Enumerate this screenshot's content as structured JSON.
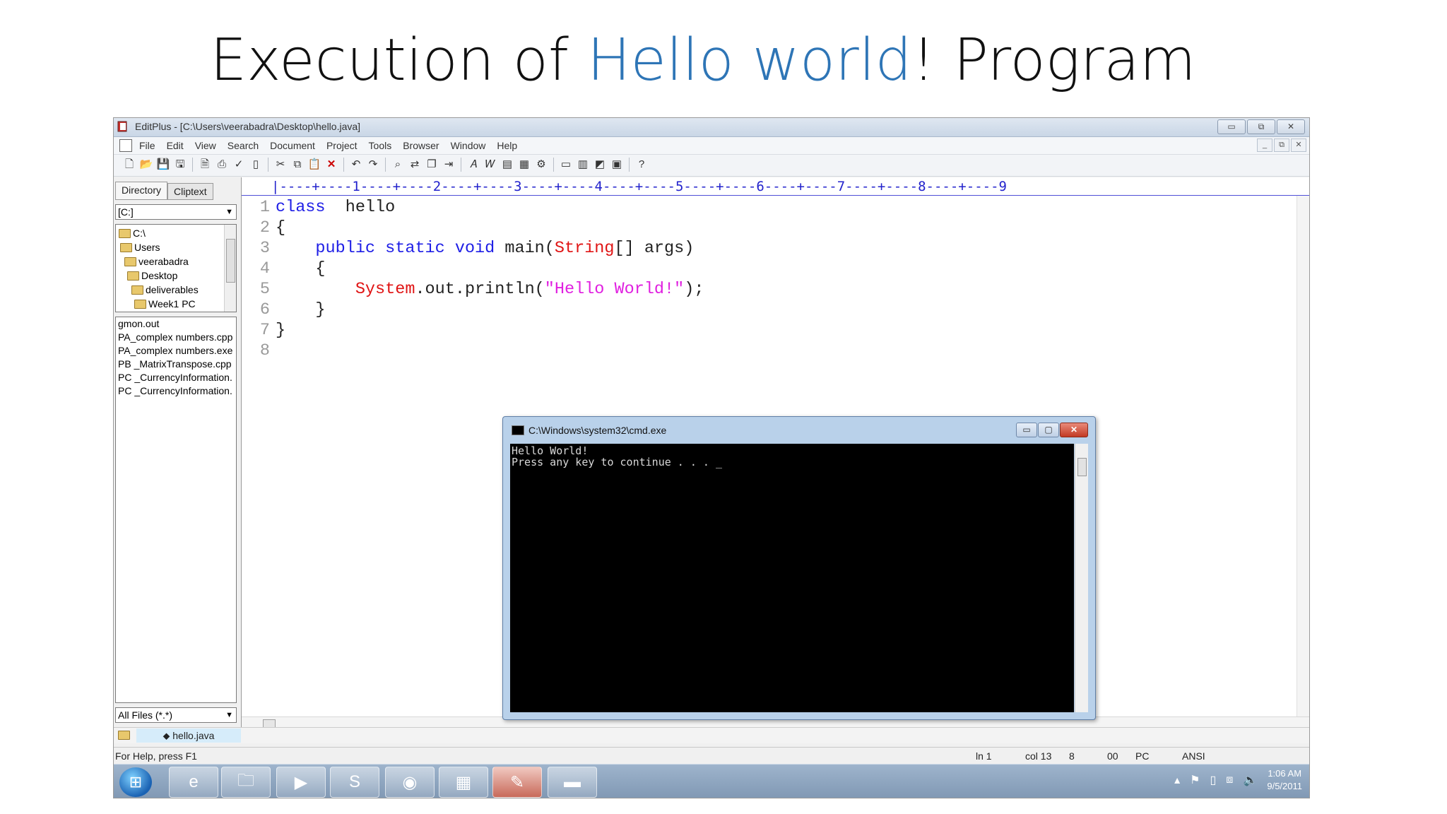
{
  "slide": {
    "title_pre": "Execution of ",
    "title_hl": "Hello world",
    "title_post": "! Program"
  },
  "window": {
    "title": "EditPlus - [C:\\Users\\veerabadra\\Desktop\\hello.java]",
    "btn_min": "▭",
    "btn_max": "⧉",
    "btn_close": "✕"
  },
  "menu": [
    "File",
    "Edit",
    "View",
    "Search",
    "Document",
    "Project",
    "Tools",
    "Browser",
    "Window",
    "Help"
  ],
  "mdi": {
    "min": "_",
    "restore": "⧉",
    "close": "✕"
  },
  "toolbar_icons": [
    "new-file-icon",
    "open-folder-icon",
    "save-icon",
    "save-all-icon",
    "print-preview-icon",
    "print-icon",
    "spellcheck-icon",
    "page-icon",
    "cut-icon",
    "copy-icon",
    "paste-icon",
    "delete-icon",
    "undo-icon",
    "redo-icon",
    "find-icon",
    "replace-icon",
    "copy-doc-icon",
    "indent-icon",
    "font-icon",
    "word-wrap-icon",
    "ruler-icon",
    "column-icon",
    "settings-icon",
    "window-icon",
    "tile-icon",
    "browser-icon",
    "cliptext-icon",
    "help-icon"
  ],
  "left_panel": {
    "tab_directory": "Directory",
    "tab_cliptext": "Cliptext",
    "drive": "[C:]",
    "tree": [
      "C:\\",
      "Users",
      "veerabadra",
      "Desktop",
      "deliverables",
      "Week1 PC"
    ],
    "files": [
      "gmon.out",
      "PA_complex numbers.cpp",
      "PA_complex numbers.exe",
      "PB _MatrixTranspose.cpp",
      "PC _CurrencyInformation.",
      "PC _CurrencyInformation."
    ],
    "filter": "All Files (*.*)"
  },
  "doc_tab": "hello.java",
  "ruler": "|----+----1----+----2----+----3----+----4----+----5----+----6----+----7----+----8----+----9",
  "code": {
    "line_numbers": [
      "1",
      "2",
      "3",
      "4",
      "5",
      "6",
      "7",
      "8"
    ],
    "l1_kw": "class",
    "l1_rest": "  hello",
    "l2": "{",
    "l3_indent": "    ",
    "l3_kw": "public static void",
    "l3_mid": " main(",
    "l3_type": "String",
    "l3_rest": "[] args)",
    "l4": "    {",
    "l5_indent": "        ",
    "l5_type": "System",
    "l5_mid": ".out.println(",
    "l5_str": "\"Hello World!\"",
    "l5_rest": ");",
    "l6": "    }",
    "l7": "}",
    "l8": ""
  },
  "cmd": {
    "title": "C:\\Windows\\system32\\cmd.exe",
    "output": "Hello World!\nPress any key to continue . . . _"
  },
  "status": {
    "help": "For Help, press F1",
    "ln": "ln 1",
    "col": "col 13",
    "n8": "8",
    "n00": "00",
    "pc": "PC",
    "enc": "ANSI"
  },
  "taskbar": {
    "time": "1:06 AM",
    "date": "9/5/2011",
    "apps": [
      "internet-explorer-icon",
      "file-explorer-icon",
      "media-player-icon",
      "skype-icon",
      "firefox-icon",
      "powerpoint-icon",
      "editplus-icon",
      "cmd-icon"
    ]
  }
}
